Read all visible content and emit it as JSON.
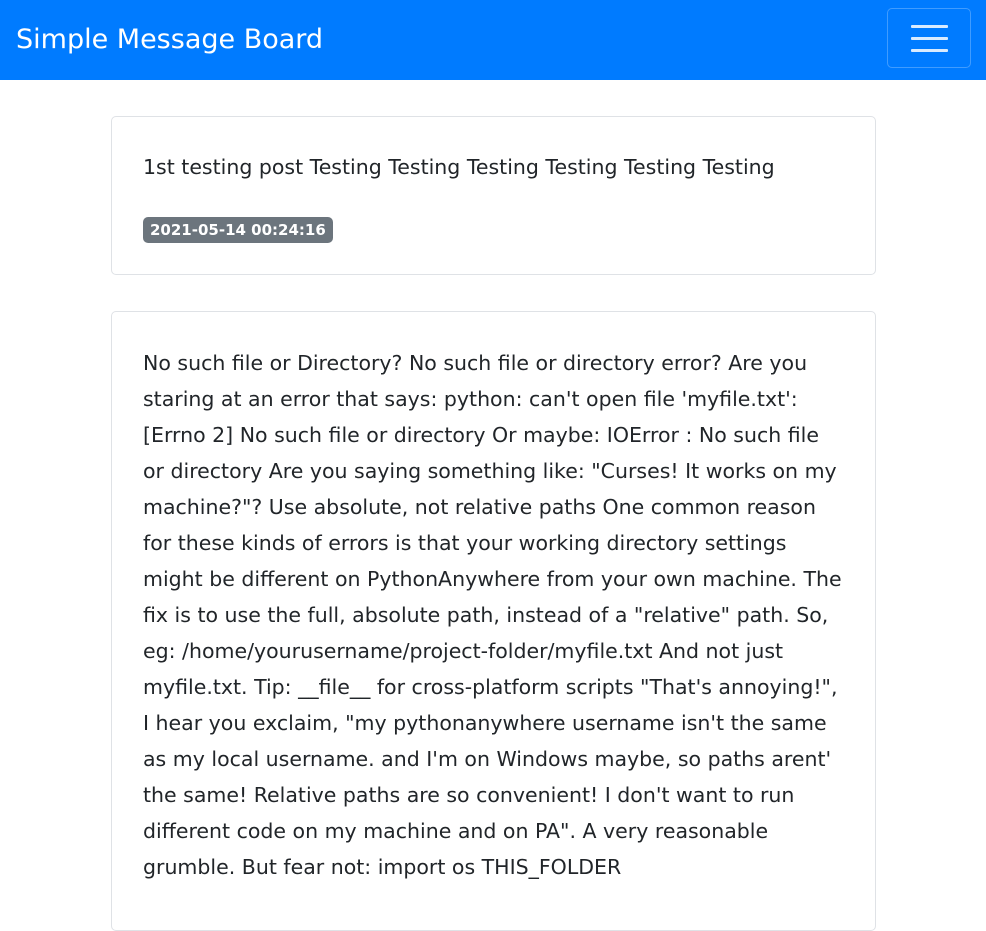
{
  "navbar": {
    "brand": "Simple Message Board",
    "toggle_icon": "hamburger-menu-icon",
    "background_color": "#007bff"
  },
  "posts": [
    {
      "text": "1st testing post Testing Testing Testing Testing Testing Testing",
      "timestamp": "2021-05-14 00:24:16"
    },
    {
      "text": "No such file or Directory? No such file or directory error? Are you staring at an error that says: python: can't open file 'myfile.txt': [Errno 2] No such file or directory Or maybe: IOError : No such file or directory Are you saying something like: \"Curses! It works on my machine?\"? Use absolute, not relative paths One common reason for these kinds of errors is that your working directory settings might be different on PythonAnywhere from your own machine. The fix is to use the full, absolute path, instead of a \"relative\" path. So, eg: /home/yourusername/project-folder/myfile.txt And not just myfile.txt. Tip: __file__ for cross-platform scripts \"That's annoying!\", I hear you exclaim, \"my pythonanywhere username isn't the same as my local username. and I'm on Windows maybe, so paths arent' the same! Relative paths are so convenient! I don't want to run different code on my machine and on PA\". A very reasonable grumble. But fear not: import os THIS_FOLDER"
    }
  ],
  "badge_color": "#6c757d"
}
